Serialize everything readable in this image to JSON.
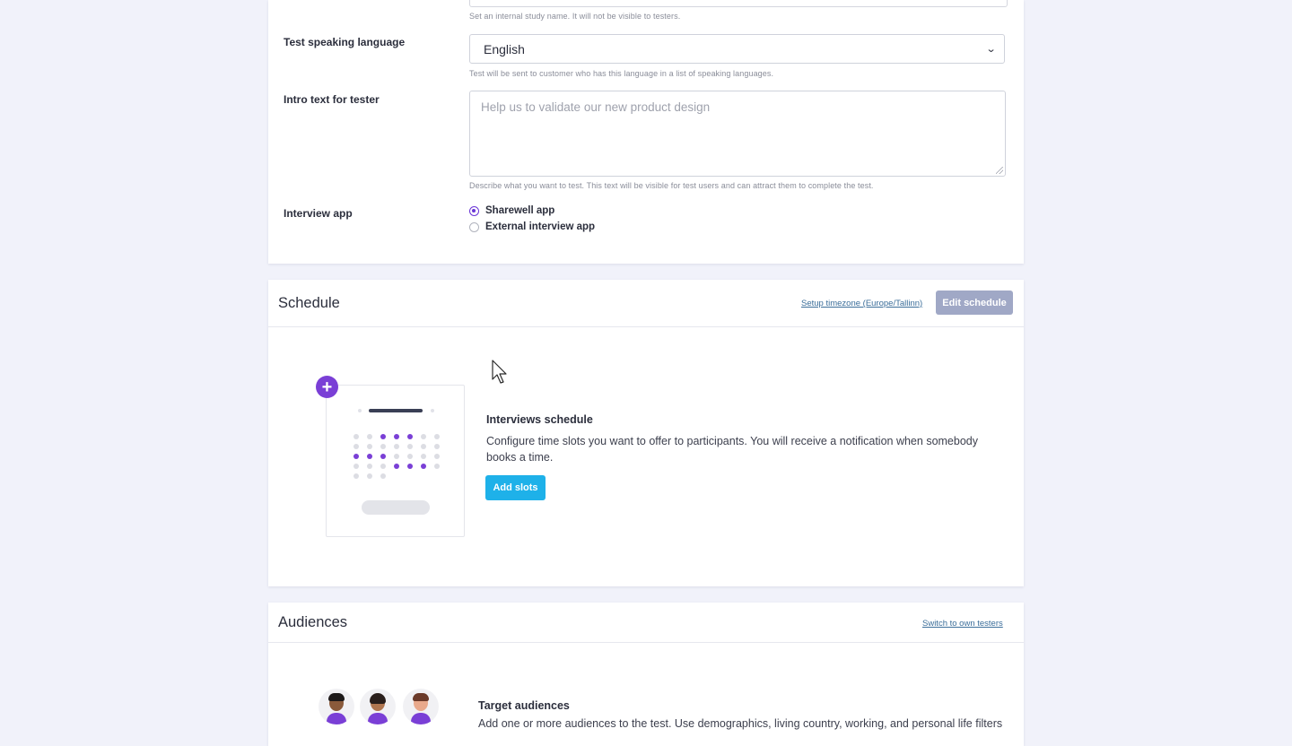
{
  "settings": {
    "study_name_help": "Set an internal study name. It will not be visible to testers.",
    "language_label": "Test speaking language",
    "language_value": "English",
    "language_help": "Test will be sent to customer who has this language in a list of speaking languages.",
    "intro_label": "Intro text for tester",
    "intro_placeholder": "Help us to validate our new product design",
    "intro_help": "Describe what you want to test. This text will be visible for test users and can attract them to complete the test.",
    "interview_label": "Interview app",
    "interview_options": [
      {
        "label": "Sharewell app",
        "checked": true
      },
      {
        "label": "External interview app",
        "checked": false
      }
    ]
  },
  "schedule": {
    "title": "Schedule",
    "timezone_link": "Setup timezone (Europe/Tallinn)",
    "edit_button": "Edit schedule",
    "plus_icon": "+",
    "heading": "Interviews schedule",
    "description": "Configure time slots you want to offer to participants. You will receive a notification when somebody books a time.",
    "add_button": "Add slots"
  },
  "audiences": {
    "title": "Audiences",
    "switch_link": "Switch to own testers",
    "heading": "Target audiences",
    "description": "Add one or more audiences to the test. Use demographics, living country, working, and personal life filters"
  },
  "colors": {
    "page_bg": "#f1f2fa",
    "accent_purple": "#7a3fd6",
    "primary_button": "#1eb1e9",
    "disabled_button": "#a0a8c6",
    "link": "#3b6e9a"
  },
  "icons": [
    "chevron-down-icon",
    "plus-icon",
    "calendar-illustration",
    "avatar-icon",
    "cursor-arrow-icon"
  ]
}
